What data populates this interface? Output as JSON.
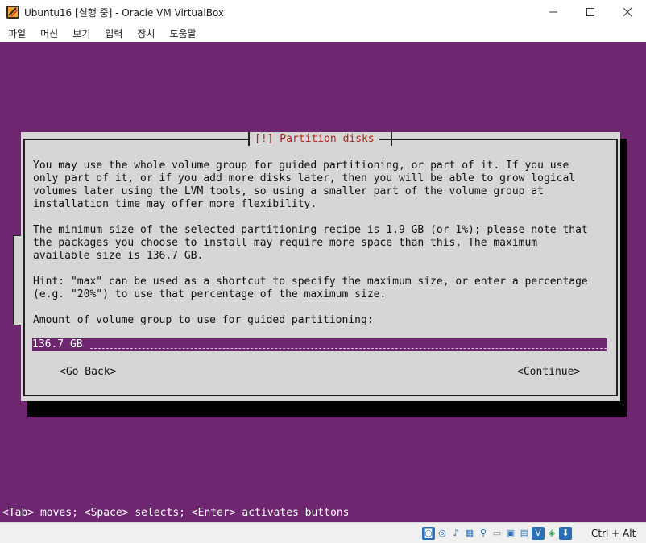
{
  "window": {
    "title": "Ubuntu16 [실행 중] - Oracle VM VirtualBox",
    "controls": {
      "minimize": "—",
      "maximize": "☐",
      "close": "✕"
    }
  },
  "menu": {
    "items": [
      "파일",
      "머신",
      "보기",
      "입력",
      "장치",
      "도움말"
    ]
  },
  "dialog": {
    "title": "[!] Partition disks",
    "paragraph1": "You may use the whole volume group for guided partitioning, or part of it. If you use\nonly part of it, or if you add more disks later, then you will be able to grow logical\nvolumes later using the LVM tools, so using a smaller part of the volume group at\ninstallation time may offer more flexibility.",
    "paragraph2": "The minimum size of the selected partitioning recipe is 1.9 GB (or 1%); please note that\nthe packages you choose to install may require more space than this. The maximum\navailable size is 136.7 GB.",
    "paragraph3": "Hint: \"max\" can be used as a shortcut to specify the maximum size, or enter a percentage\n(e.g. \"20%\") to use that percentage of the maximum size.",
    "prompt": "Amount of volume group to use for guided partitioning:",
    "input_value": "136.7 GB",
    "go_back": "<Go Back>",
    "continue": "<Continue>"
  },
  "help_line": "<Tab> moves; <Space> selects; <Enter> activates buttons",
  "status": {
    "host_key": "Ctrl + Alt",
    "icons": [
      "hard-disk-icon",
      "optical-drive-icon",
      "audio-icon",
      "network-icon",
      "usb-icon",
      "shared-folder-icon",
      "display-icon",
      "video-capture-icon",
      "cpu-icon",
      "mouse-integration-icon",
      "keyboard-icon"
    ]
  },
  "colors": {
    "vm_background": "#6e2670",
    "dialog_background": "#d6d6d6",
    "dialog_title": "#b0251b",
    "input_background": "#6e2670"
  }
}
